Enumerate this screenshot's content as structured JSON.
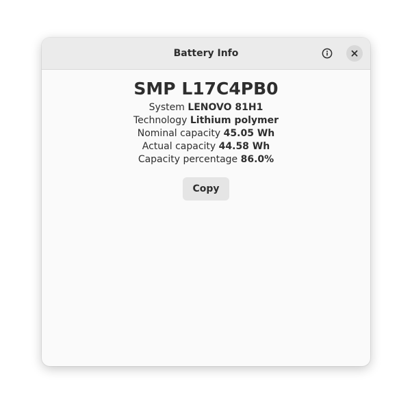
{
  "window": {
    "title": "Battery Info"
  },
  "header": {
    "info_icon": "info-circle-icon",
    "close_icon": "close-icon"
  },
  "battery": {
    "model": "SMP L17C4PB0",
    "rows": [
      {
        "label": "System",
        "value": "LENOVO 81H1"
      },
      {
        "label": "Technology",
        "value": "Lithium polymer"
      },
      {
        "label": "Nominal capacity",
        "value": "45.05 Wh"
      },
      {
        "label": "Actual capacity",
        "value": "44.58 Wh"
      },
      {
        "label": "Capacity percentage",
        "value": "86.0%"
      }
    ]
  },
  "actions": {
    "copy_label": "Copy"
  },
  "colors": {
    "window_bg": "#fafafa",
    "headerbar_bg": "#ebebeb",
    "button_bg": "#e5e5e5",
    "text": "#2e2e2e"
  }
}
